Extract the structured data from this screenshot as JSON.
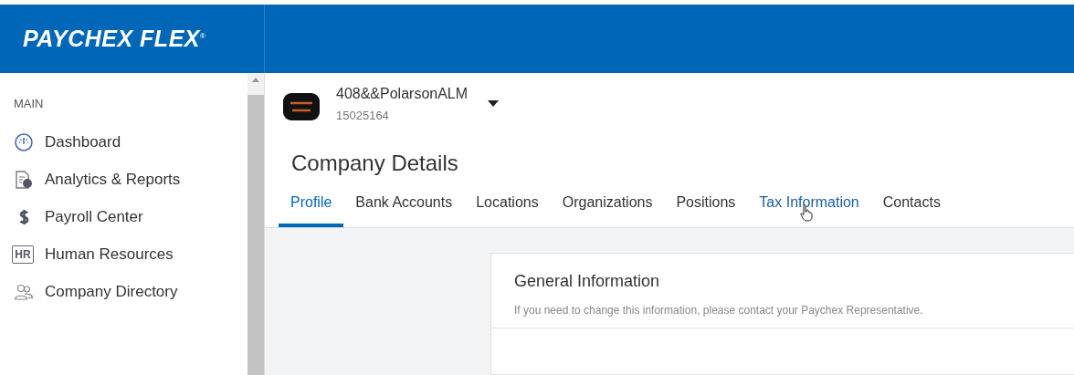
{
  "header": {
    "logo": "PAYCHEX FLEX",
    "logo_mark": "®"
  },
  "sidebar": {
    "section": "MAIN",
    "items": [
      {
        "label": "Dashboard",
        "kind": "gauge",
        "selected": false
      },
      {
        "label": "Analytics & Reports",
        "kind": "report",
        "selected": false
      },
      {
        "label": "Payroll Center",
        "kind": "dollar",
        "selected": false
      },
      {
        "label": "Human Resources",
        "kind": "hr",
        "icon_text": "HR",
        "selected": false
      },
      {
        "label": "Company Directory",
        "kind": "people",
        "selected": false
      }
    ]
  },
  "company": {
    "name": "408&&PolarsonALM",
    "id": "15025164"
  },
  "page_title": "Company Details",
  "tabs": [
    {
      "label": "Profile",
      "selected": true,
      "hovered": false
    },
    {
      "label": "Bank Accounts",
      "selected": false,
      "hovered": false
    },
    {
      "label": "Locations",
      "selected": false,
      "hovered": false
    },
    {
      "label": "Organizations",
      "selected": false,
      "hovered": false
    },
    {
      "label": "Positions",
      "selected": false,
      "hovered": false
    },
    {
      "label": "Tax Information",
      "selected": false,
      "hovered": true
    },
    {
      "label": "Contacts",
      "selected": false,
      "hovered": false
    }
  ],
  "card": {
    "title": "General Information",
    "note": "If you need to change this information, please contact your Paychex Representative."
  }
}
